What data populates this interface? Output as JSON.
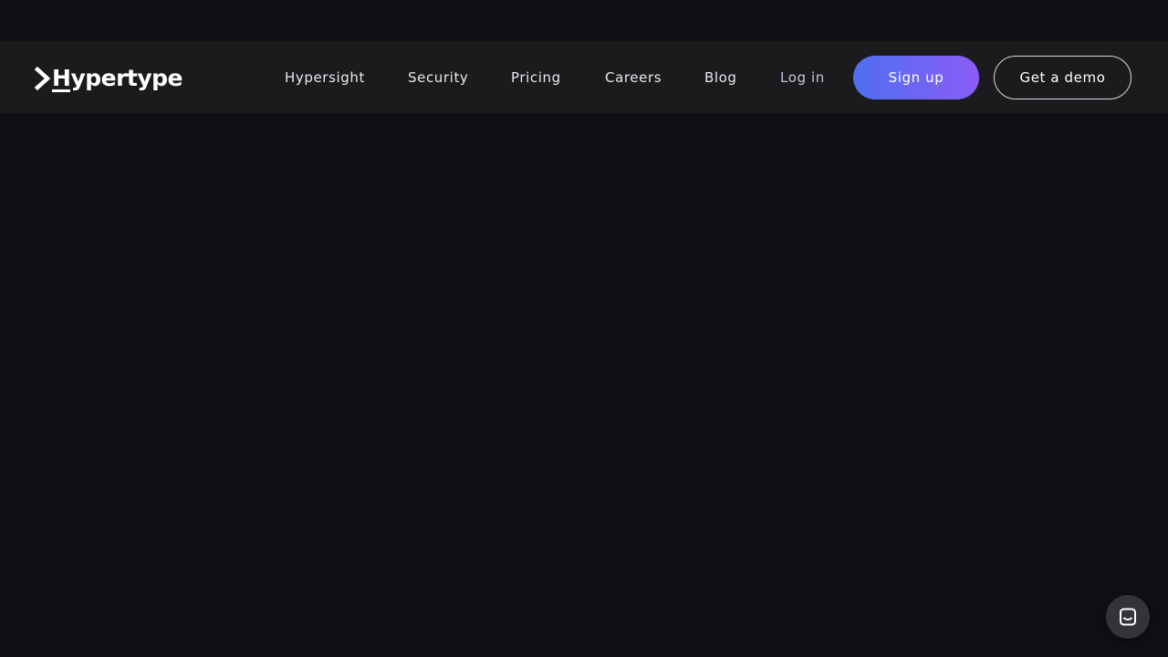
{
  "brand": {
    "name_prefix": "H",
    "name_rest": "ypertype",
    "logo_icon": "chevron-right-icon"
  },
  "nav": {
    "items": [
      {
        "label": "Hypersight"
      },
      {
        "label": "Security"
      },
      {
        "label": "Pricing"
      },
      {
        "label": "Careers"
      },
      {
        "label": "Blog"
      }
    ],
    "login_label": "Log in",
    "signup_label": "Sign up",
    "demo_label": "Get a demo"
  },
  "chat": {
    "icon": "chat-icon"
  },
  "colors": {
    "page_background": "#0f0f14",
    "navbar_background": "#1b1b1d",
    "signup_gradient_start": "#4f6ff0",
    "signup_gradient_end": "#8b5cf6"
  }
}
